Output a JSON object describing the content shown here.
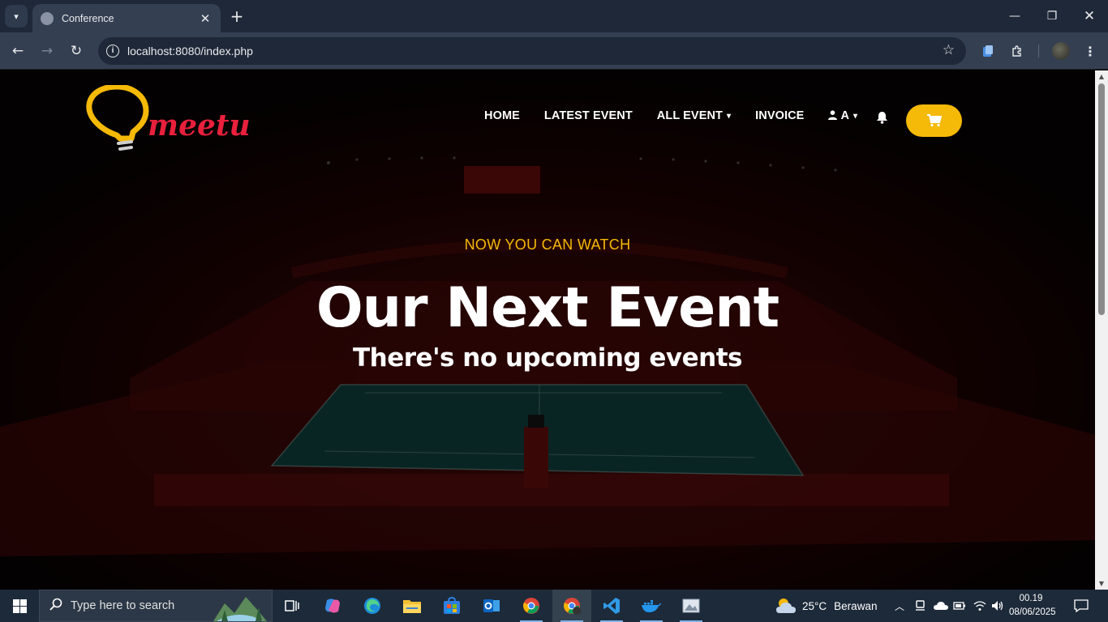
{
  "browser": {
    "tab_title": "Conference",
    "url": "localhost:8080/index.php"
  },
  "site": {
    "logo_text": "meetup",
    "nav": {
      "home": "HOME",
      "latest_event": "LATEST EVENT",
      "all_event": "ALL EVENT",
      "invoice": "INVOICE",
      "user": "A"
    },
    "accent_color": "#f5b907"
  },
  "hero": {
    "kicker": "NOW YOU CAN WATCH",
    "title": "Our Next Event",
    "subtitle": "There's no upcoming events"
  },
  "taskbar": {
    "search_placeholder": "Type here to search",
    "weather_temp": "25°C",
    "weather_desc": "Berawan",
    "time": "00.19",
    "date": "08/06/2025"
  }
}
